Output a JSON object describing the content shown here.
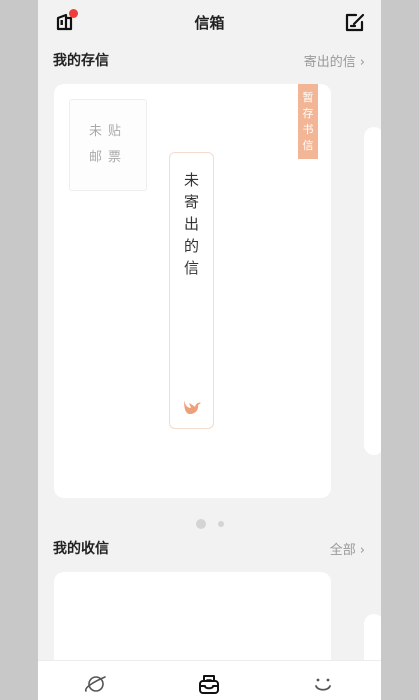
{
  "header": {
    "title": "信箱",
    "left_icon": "mail-notification-icon",
    "right_icon": "compose-icon",
    "accent_color": "#ee3d3d"
  },
  "stored_letters": {
    "section_label": "我的存信",
    "more_link": "寄出的信",
    "chevron": "›",
    "stamp_line1": "未贴",
    "stamp_line2": "邮票",
    "draft_tag": [
      "暂",
      "存",
      "书",
      "信"
    ],
    "draft_tag_color": "#f2b595",
    "envelope_text": [
      "未",
      "寄",
      "出",
      "的",
      "信"
    ],
    "envelope_icon": "bird-icon",
    "pager": {
      "pages": 2,
      "active": 1
    }
  },
  "received_letters": {
    "section_label": "我的收信",
    "more_link": "全部",
    "chevron": "›"
  },
  "tabbar": {
    "tabs": [
      {
        "icon": "planet-icon",
        "active": false
      },
      {
        "icon": "mailbox-icon",
        "active": true
      },
      {
        "icon": "smile-icon",
        "active": false
      }
    ]
  }
}
